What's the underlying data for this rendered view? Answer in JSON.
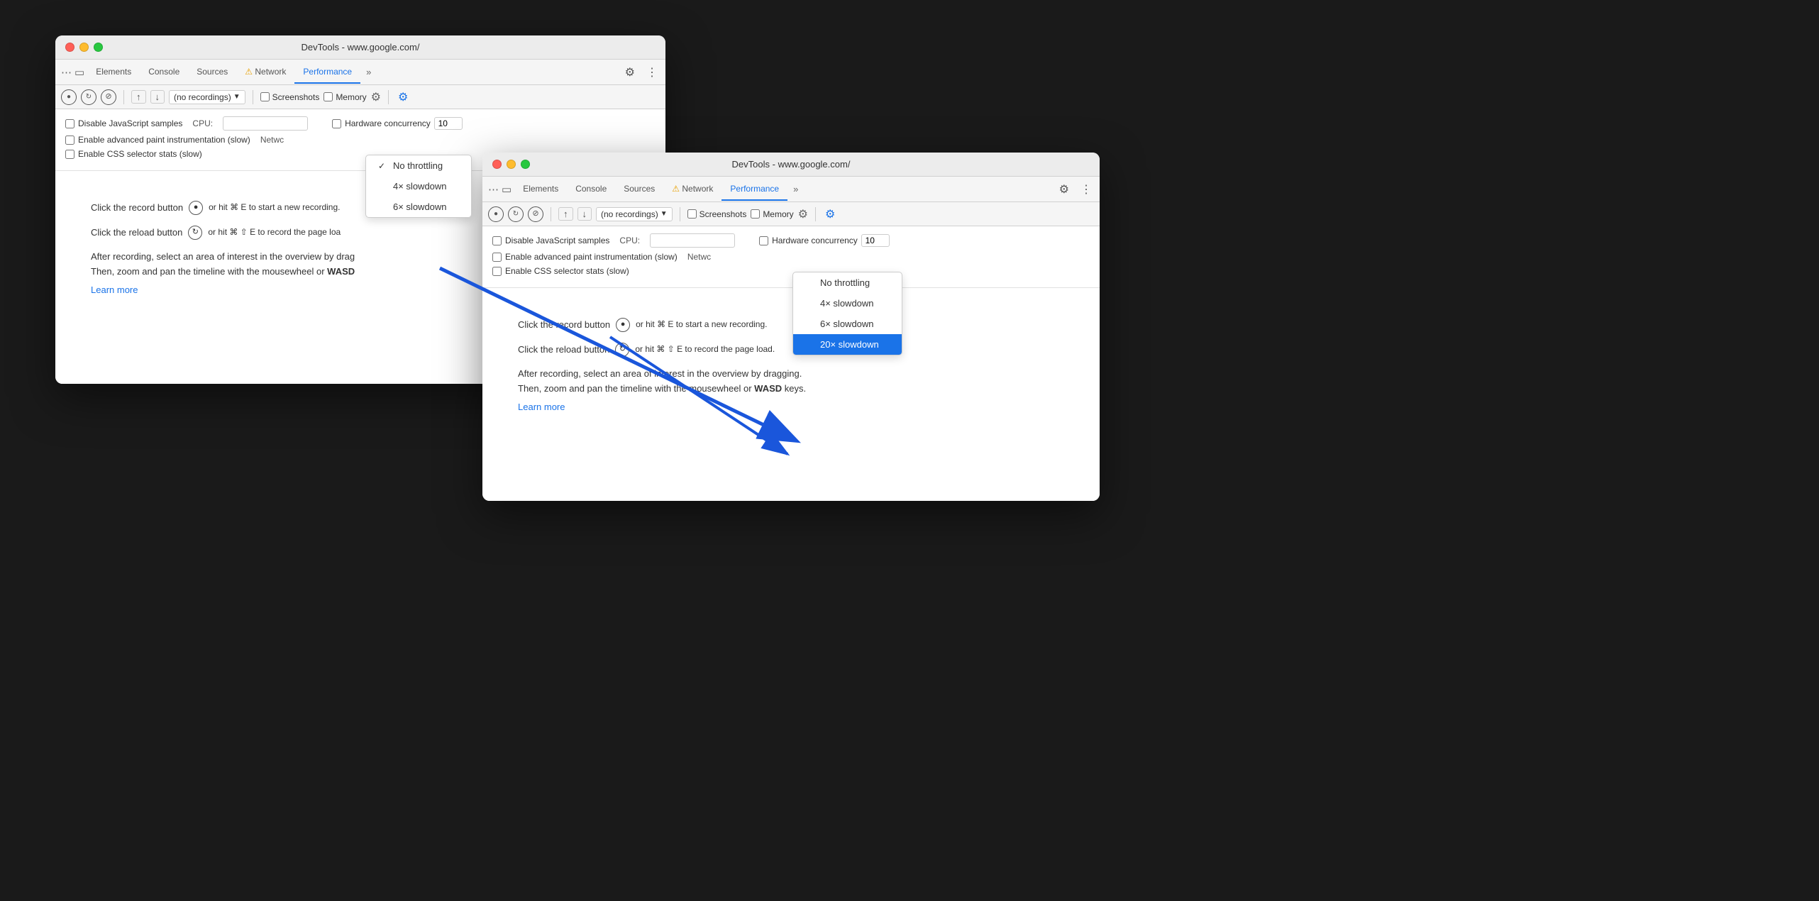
{
  "window1": {
    "title": "DevTools - www.google.com/",
    "tabs": [
      "Elements",
      "Console",
      "Sources",
      "Network",
      "Performance",
      ">>"
    ],
    "network_tab_warning": true,
    "performance_tab_active": true,
    "toolbar": {
      "recordings_placeholder": "(no recordings)",
      "screenshots_label": "Screenshots",
      "memory_label": "Memory"
    },
    "settings": {
      "disable_js_label": "Disable JavaScript samples",
      "cpu_label": "CPU:",
      "network_label": "Netwc",
      "advanced_paint_label": "Enable advanced paint instrumentation (slow)",
      "hardware_concurrency_label": "Hardware concurrency",
      "hardware_concurrency_value": "10",
      "css_selector_label": "Enable CSS selector stats (slow)"
    },
    "dropdown": {
      "items": [
        {
          "label": "No throttling",
          "checked": true,
          "highlighted": false
        },
        {
          "label": "4× slowdown",
          "checked": false,
          "highlighted": false
        },
        {
          "label": "6× slowdown",
          "checked": false,
          "highlighted": false
        }
      ]
    },
    "content": {
      "record_text": "Click the record button",
      "record_shortcut": "⌘ E",
      "record_suffix": "to start a new recording.",
      "reload_text": "Click the reload button",
      "reload_shortcut": "⌘ ⇧ E",
      "reload_suffix": "to record the page load.",
      "after_text": "After recording, select an area of interest in the overview by drag",
      "then_text": "Then, zoom and pan the timeline with the mousewheel or WASD",
      "learn_more": "Learn more"
    }
  },
  "window2": {
    "title": "DevTools - www.google.com/",
    "tabs": [
      "Elements",
      "Console",
      "Sources",
      "Network",
      "Performance",
      ">>"
    ],
    "network_tab_warning": true,
    "performance_tab_active": true,
    "toolbar": {
      "recordings_placeholder": "(no recordings)",
      "screenshots_label": "Screenshots",
      "memory_label": "Memory"
    },
    "settings": {
      "disable_js_label": "Disable JavaScript samples",
      "cpu_label": "CPU:",
      "network_label": "Netwc",
      "advanced_paint_label": "Enable advanced paint instrumentation (slow)",
      "hardware_concurrency_label": "Hardware concurrency",
      "hardware_concurrency_value": "10",
      "css_selector_label": "Enable CSS selector stats (slow)"
    },
    "dropdown": {
      "items": [
        {
          "label": "No throttling",
          "checked": false,
          "highlighted": false
        },
        {
          "label": "4× slowdown",
          "checked": false,
          "highlighted": false
        },
        {
          "label": "6× slowdown",
          "checked": false,
          "highlighted": false
        },
        {
          "label": "20× slowdown",
          "checked": false,
          "highlighted": true
        }
      ]
    },
    "content": {
      "record_text": "Click the record button",
      "record_shortcut": "⌘ E",
      "record_suffix": "to start a new recording.",
      "reload_text": "Click the reload button",
      "reload_shortcut": "⌘ ⇧ E",
      "reload_suffix": "to record the page load.",
      "after_text": "After recording, select an area of interest in the overview by dragging.",
      "then_text": "Then, zoom and pan the timeline with the mousewheel or WASD keys.",
      "learn_more": "Learn more"
    }
  }
}
